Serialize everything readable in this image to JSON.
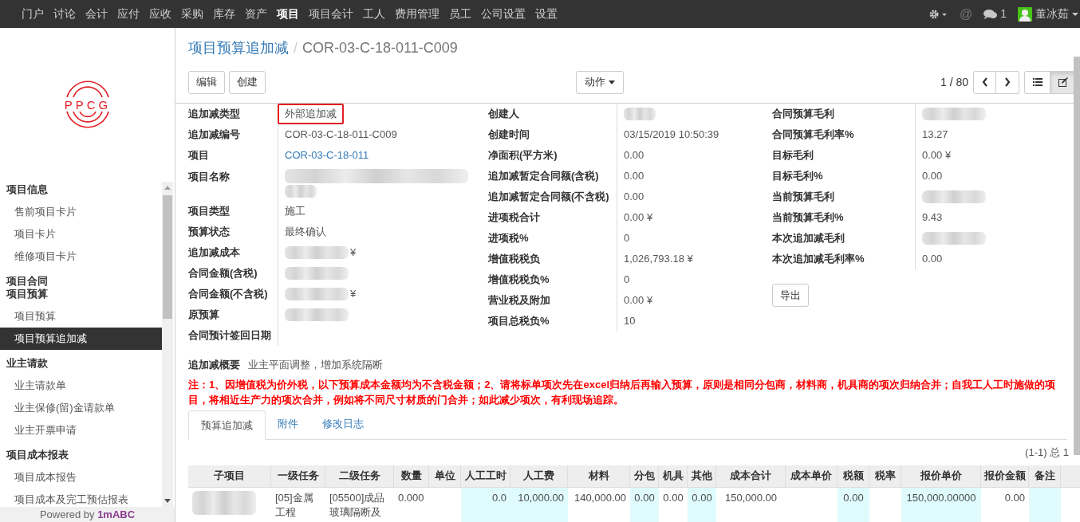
{
  "topnav": {
    "items": [
      {
        "label": "门户",
        "selected": false
      },
      {
        "label": "讨论",
        "selected": false
      },
      {
        "label": "会计",
        "selected": false
      },
      {
        "label": "应付",
        "selected": false
      },
      {
        "label": "应收",
        "selected": false
      },
      {
        "label": "采购",
        "selected": false
      },
      {
        "label": "库存",
        "selected": false
      },
      {
        "label": "资产",
        "selected": false
      },
      {
        "label": "项目",
        "selected": true
      },
      {
        "label": "项目会计",
        "selected": false
      },
      {
        "label": "工人",
        "selected": false
      },
      {
        "label": "费用管理",
        "selected": false
      },
      {
        "label": "员工",
        "selected": false
      },
      {
        "label": "公司设置",
        "selected": false
      },
      {
        "label": "设置",
        "selected": false
      }
    ],
    "at_sign": "@",
    "message_count": "1",
    "user_name": "董冰茹"
  },
  "logo_text": "PPCG",
  "sidebar": {
    "sections": [
      {
        "title": "项目信息",
        "items": [
          {
            "label": "售前项目卡片",
            "selected": false
          },
          {
            "label": "项目卡片",
            "selected": false
          },
          {
            "label": "维修项目卡片",
            "selected": false
          }
        ]
      },
      {
        "title": "项目合同"
      },
      {
        "title": "项目预算",
        "items": [
          {
            "label": "项目预算",
            "selected": false
          },
          {
            "label": "项目预算追加减",
            "selected": true
          }
        ]
      },
      {
        "title": "业主请款",
        "items": [
          {
            "label": "业主请款单",
            "selected": false
          },
          {
            "label": "业主保修(留)金请款单",
            "selected": false
          },
          {
            "label": "业主开票申请",
            "selected": false
          }
        ]
      },
      {
        "title": "项目成本报表",
        "items": [
          {
            "label": "项目成本报告",
            "selected": false
          },
          {
            "label": "项目成本及完工预估报表",
            "selected": false
          }
        ]
      }
    ]
  },
  "footer": {
    "prefix": "Powered by",
    "brand": "1mABC"
  },
  "breadcrumb": {
    "parent": "项目预算追加减",
    "separator": "/",
    "current": "COR-03-C-18-011-C009"
  },
  "buttons": [
    "编辑",
    "创建"
  ],
  "action_button": "动作",
  "pager": "1 / 80",
  "views": [
    {
      "kind": "list",
      "selected": false
    },
    {
      "kind": "form",
      "selected": true
    }
  ],
  "form_columns": [
    [
      {
        "label": "追加减类型",
        "kind": "text",
        "value": "外部追加减",
        "highlighted": true
      },
      {
        "label": "追加减编号",
        "kind": "text",
        "value": "COR-03-C-18-011-C009"
      },
      {
        "label": "项目",
        "kind": "link",
        "value": "COR-03-C-18-011"
      },
      {
        "label": "项目名称",
        "kind": "blurred_tall"
      },
      {
        "label": "项目类型",
        "kind": "text",
        "value": "施工"
      },
      {
        "label": "预算状态",
        "kind": "text",
        "value": "最终确认"
      },
      {
        "label": "追加减成本",
        "kind": "blurred",
        "suffix": "¥"
      },
      {
        "label": "合同金额(含税)",
        "kind": "blurred"
      },
      {
        "label": "合同金额(不含税)",
        "kind": "blurred",
        "suffix": "¥"
      },
      {
        "label": "原预算",
        "kind": "blurred"
      },
      {
        "label": "合同预计签回日期",
        "kind": "empty"
      }
    ],
    [
      {
        "label": "创建人",
        "kind": "blurred"
      },
      {
        "label": "创建时间",
        "kind": "text",
        "value": "03/15/2019 10:50:39"
      },
      {
        "label": "净面积(平方米)",
        "kind": "text",
        "value": "0.00"
      },
      {
        "label": "追加减暂定合同额(含税)",
        "kind": "text",
        "value": "0.00"
      },
      {
        "label": "追加减暂定合同额(不含税)",
        "kind": "text",
        "value": "0.00"
      },
      {
        "label": "进项税合计",
        "kind": "text",
        "value": "0.00 ¥"
      },
      {
        "label": "进项税%",
        "kind": "text",
        "value": "0"
      },
      {
        "label": "增值税税负",
        "kind": "text",
        "value": "1,026,793.18 ¥"
      },
      {
        "label": "增值税税负%",
        "kind": "text",
        "value": "0"
      },
      {
        "label": "营业税及附加",
        "kind": "text",
        "value": "0.00 ¥"
      },
      {
        "label": "项目总税负%",
        "kind": "text",
        "value": "10"
      }
    ],
    [
      {
        "label": "合同预算毛利",
        "kind": "blurred"
      },
      {
        "label": "合同预算毛利率%",
        "kind": "text",
        "value": "13.27"
      },
      {
        "label": "目标毛利",
        "kind": "text",
        "value": "0.00 ¥"
      },
      {
        "label": "目标毛利%",
        "kind": "text",
        "value": "0.00"
      },
      {
        "label": "当前预算毛利",
        "kind": "blurred"
      },
      {
        "label": "当前预算毛利%",
        "kind": "text",
        "value": "9.43"
      },
      {
        "label": "本次追加减毛利",
        "kind": "blurred"
      },
      {
        "label": "本次追加减毛利率%",
        "kind": "text",
        "value": "0.00"
      }
    ]
  ],
  "export_button": "导出",
  "overview": {
    "label": "追加减概要",
    "value": "业主平面调整，增加系统隔断"
  },
  "note": "注：1、因增值税为价外税，以下预算成本金额均为不含税金额；2、请将标单项次先在excel归纳后再输入预算，原则是相同分包商，材料商，机具商的项次归纳合并；自我工人工时施做的项目，将相近生产力的项次合并，例如将不同尺寸材质的门合并；如此减少项次，有利现场追踪。",
  "tabs": [
    {
      "label": "预算追加减",
      "selected": true
    },
    {
      "label": "附件",
      "selected": false
    },
    {
      "label": "修改日志",
      "selected": false
    }
  ],
  "table": {
    "pager": "(1-1) 总 1",
    "columns": [
      {
        "label": "子项目",
        "editable": false
      },
      {
        "label": "一级任务",
        "editable": false
      },
      {
        "label": "二级任务",
        "editable": false
      },
      {
        "label": "数量",
        "editable": false
      },
      {
        "label": "单位",
        "editable": false
      },
      {
        "label": "人工工时",
        "editable": true
      },
      {
        "label": "人工费",
        "editable": true
      },
      {
        "label": "材料",
        "editable": false
      },
      {
        "label": "分包",
        "editable": true
      },
      {
        "label": "机具",
        "editable": false
      },
      {
        "label": "其他",
        "editable": true
      },
      {
        "label": "成本合计",
        "editable": false
      },
      {
        "label": "成本单价",
        "editable": false
      },
      {
        "label": "税额",
        "editable": true
      },
      {
        "label": "税率",
        "editable": false
      },
      {
        "label": "报价单价",
        "editable": true
      },
      {
        "label": "报价金额",
        "editable": false
      },
      {
        "label": "备注",
        "editable": true
      }
    ],
    "rows": [
      {
        "cells": [
          {
            "kind": "blurred"
          },
          {
            "kind": "text",
            "value": "[05]金属工程"
          },
          {
            "kind": "text",
            "value": "[05500]成品玻璃隔断及"
          },
          {
            "kind": "text",
            "value": "0.000"
          },
          {
            "kind": "empty"
          },
          {
            "kind": "text",
            "value": "0.0"
          },
          {
            "kind": "text",
            "value": "10,000.00"
          },
          {
            "kind": "text",
            "value": "140,000.00"
          },
          {
            "kind": "text",
            "value": "0.00"
          },
          {
            "kind": "text",
            "value": "0.00"
          },
          {
            "kind": "text",
            "value": "0.00"
          },
          {
            "kind": "text",
            "value": "150,000.00"
          },
          {
            "kind": "empty"
          },
          {
            "kind": "text",
            "value": "0.00"
          },
          {
            "kind": "empty"
          },
          {
            "kind": "text",
            "value": "150,000.00000"
          },
          {
            "kind": "text",
            "value": "0.00"
          },
          {
            "kind": "empty"
          }
        ]
      }
    ]
  }
}
